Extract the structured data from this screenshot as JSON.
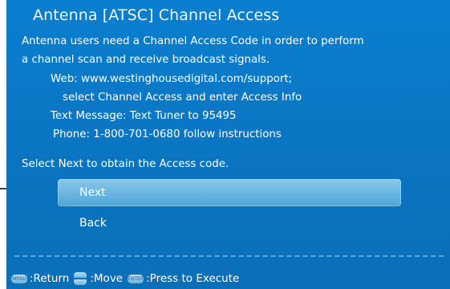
{
  "screen": {
    "title": "Antenna [ATSC] Channel Access",
    "info_lines": [
      "Antenna users need a Channel Access Code in order to perform",
      "a channel scan and receive broadcast signals.",
      "Web: www.westinghousedigital.com/support;",
      "select Channel Access and enter Access Info",
      "Text Message: Text Tuner to 95495",
      "Phone: 1-800-701-0680 follow instructions"
    ],
    "prompt": "Select Next to obtain the Access code."
  },
  "menu": {
    "items": [
      {
        "label": "Next",
        "selected": true
      },
      {
        "label": "Back",
        "selected": false
      }
    ]
  },
  "footer": {
    "menu_key": "MENU",
    "return_label": ":Return",
    "move_label": ":Move",
    "enter_key": "ENTER",
    "execute_label": ":Press to Execute"
  },
  "colors": {
    "background": "#0b78c6",
    "highlight": "#6bb7e2",
    "text": "#ffffff"
  },
  "icons": [
    "arrow-pointer-icon",
    "menu-key-icon",
    "updown-key-icon",
    "enter-key-icon"
  ]
}
